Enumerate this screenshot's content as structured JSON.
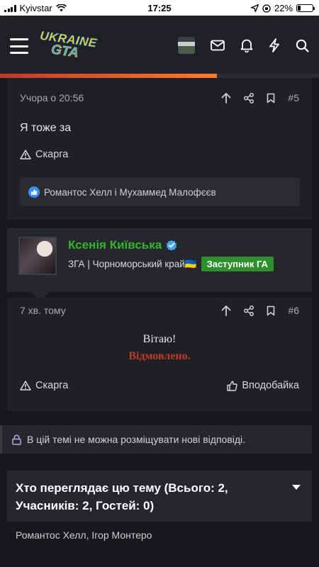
{
  "statusbar": {
    "carrier": "Kyivstar",
    "time": "17:25",
    "battery": "22%",
    "battery_level": 0.22
  },
  "header": {
    "logo_line1": "UKRAINE",
    "logo_line2": "GTA",
    "progress": 0.68
  },
  "post5": {
    "time": "Учора о 20:56",
    "number": "#5",
    "text": "Я тоже за",
    "report_label": "Скарга",
    "reactions": "Романтос Хелл і Мухаммед Малофєєв"
  },
  "author": {
    "name": "Ксенія Київська",
    "title": "ЗГА | Чорноморський край🇺🇦",
    "badge": "Заступник ГА",
    "name_color": "#36b32e",
    "badge_color": "#2f8f2c"
  },
  "post6": {
    "time": "7 хв. тому",
    "number": "#6",
    "greeting": "Вітаю!",
    "verdict": "Відмовлено.",
    "verdict_color": "#c0392b",
    "report_label": "Скарга",
    "like_label": "Вподобайка"
  },
  "thread": {
    "locked_notice": "В цій темі не можна розміщувати нові відповіді.",
    "viewers_heading": "Хто переглядає цю тему (Всього: 2, Учасників: 2, Гостей: 0)",
    "viewers_list": "Романтос Хелл, Ігор Монтеро"
  }
}
